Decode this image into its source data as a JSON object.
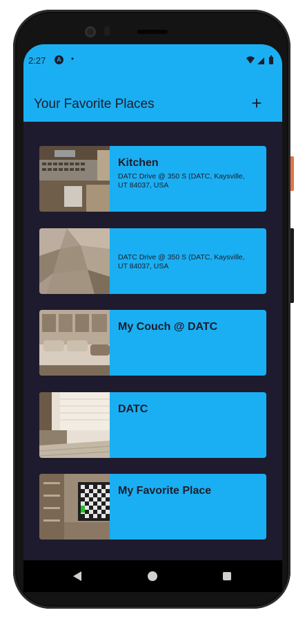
{
  "status_bar": {
    "time": "2:27",
    "icons": [
      "a-icon",
      "dot-icon",
      "wifi-icon",
      "signal-icon",
      "battery-icon"
    ]
  },
  "app_bar": {
    "title": "Your Favorite Places",
    "add_label": "+"
  },
  "places": [
    {
      "title": "Kitchen",
      "address": "DATC Drive @ 350 S (DATC, Kaysville, UT 84037, USA"
    },
    {
      "title": "",
      "address": "DATC Drive @ 350 S (DATC, Kaysville, UT 84037, USA"
    },
    {
      "title": "My Couch @ DATC",
      "address": ""
    },
    {
      "title": "DATC",
      "address": ""
    },
    {
      "title": "My Favorite Place",
      "address": ""
    }
  ],
  "nav": {
    "back": "back-icon",
    "home": "home-icon",
    "recents": "recents-icon"
  },
  "colors": {
    "accent": "#1aaff2",
    "background": "#1f1b2e",
    "text": "#1d1d2b"
  }
}
